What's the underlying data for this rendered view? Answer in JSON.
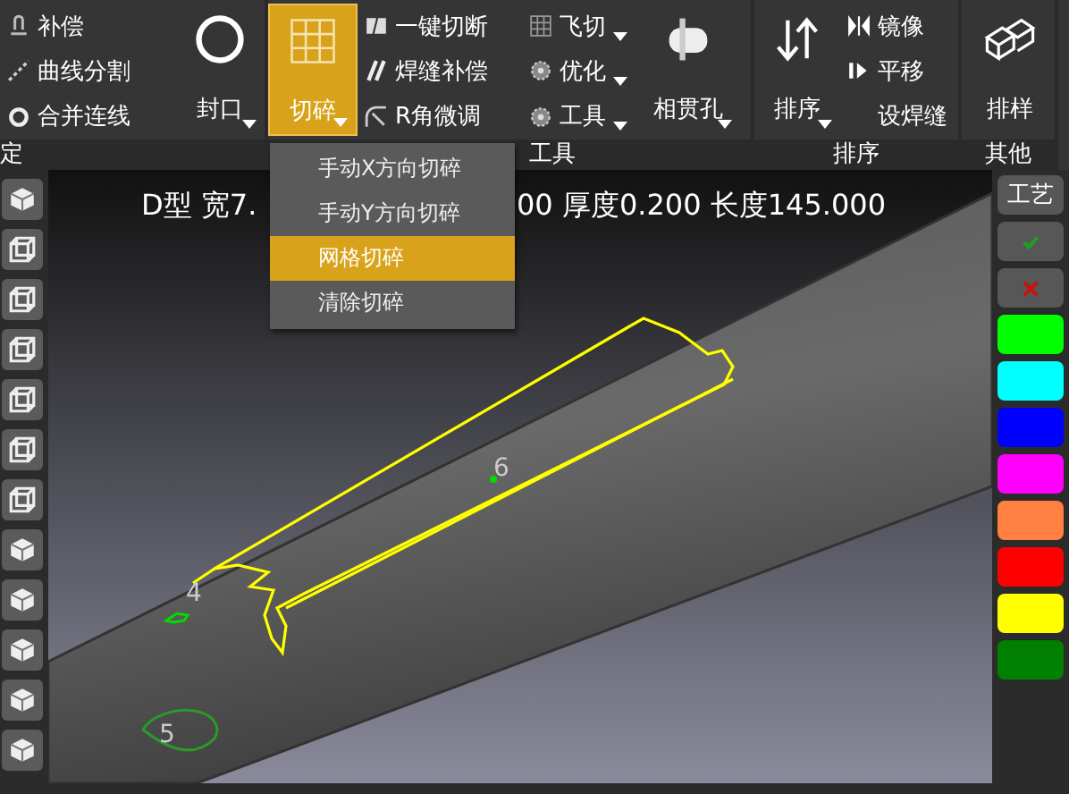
{
  "ribbon": {
    "groups": [
      {
        "label": "定",
        "columns": [
          {
            "kind": "stack",
            "items": [
              {
                "label": "补偿",
                "dropdown": false
              },
              {
                "label": "曲线分割",
                "dropdown": false
              },
              {
                "label": "合并连线",
                "dropdown": false
              }
            ]
          },
          {
            "kind": "large",
            "label": "封口",
            "dropdown": true,
            "selected": false
          }
        ]
      },
      {
        "label": "工具",
        "columns": [
          {
            "kind": "large",
            "label": "切碎",
            "dropdown": true,
            "selected": true
          },
          {
            "kind": "stack",
            "items": [
              {
                "label": "一键切断",
                "dropdown": false
              },
              {
                "label": "焊缝补偿",
                "dropdown": false
              },
              {
                "label": "R角微调",
                "dropdown": false
              }
            ]
          },
          {
            "kind": "stack",
            "items": [
              {
                "label": "飞切",
                "dropdown": true
              },
              {
                "label": "优化",
                "dropdown": true
              },
              {
                "label": "工具",
                "dropdown": true
              }
            ]
          },
          {
            "kind": "large",
            "label": "相贯孔",
            "dropdown": true,
            "selected": false
          }
        ]
      },
      {
        "label": "排序",
        "columns": [
          {
            "kind": "large",
            "label": "排序",
            "dropdown": true,
            "selected": false
          },
          {
            "kind": "stack",
            "items": [
              {
                "label": "镜像",
                "dropdown": false
              },
              {
                "label": "平移",
                "dropdown": false
              },
              {
                "label": "设焊缝",
                "dropdown": false
              }
            ]
          }
        ]
      },
      {
        "label": "其他",
        "columns": [
          {
            "kind": "large",
            "label": "排样",
            "dropdown": false,
            "selected": false
          }
        ]
      }
    ]
  },
  "dropdown_menu": [
    {
      "label": "手动X方向切碎",
      "selected": false
    },
    {
      "label": "手动Y方向切碎",
      "selected": false
    },
    {
      "label": "网格切碎",
      "selected": true
    },
    {
      "label": "清除切碎",
      "selected": false
    }
  ],
  "info_text": {
    "left": "D型 宽7.",
    "right": "00 厚度0.200 长度145.000"
  },
  "left_toolbar": [
    {
      "kind": "iso"
    },
    {
      "kind": "frame"
    },
    {
      "kind": "frame"
    },
    {
      "kind": "frame"
    },
    {
      "kind": "frame"
    },
    {
      "kind": "frame"
    },
    {
      "kind": "frame"
    },
    {
      "kind": "iso"
    },
    {
      "kind": "iso"
    },
    {
      "kind": "iso"
    },
    {
      "kind": "iso"
    },
    {
      "kind": "iso"
    }
  ],
  "viewport": {
    "point_labels": [
      "4",
      "6",
      "5"
    ]
  },
  "side_panel": {
    "process_button": "工艺",
    "actions": [
      {
        "kind": "confirm"
      },
      {
        "kind": "cancel"
      }
    ],
    "colors": [
      {
        "color": "#00ff00"
      },
      {
        "color": "#00ffff"
      },
      {
        "color": "#0000ff"
      },
      {
        "color": "#ff00ff"
      },
      {
        "color": "#ff8040"
      },
      {
        "color": "#ff0000"
      },
      {
        "color": "#ffff00"
      },
      {
        "color": "#008000"
      }
    ]
  }
}
